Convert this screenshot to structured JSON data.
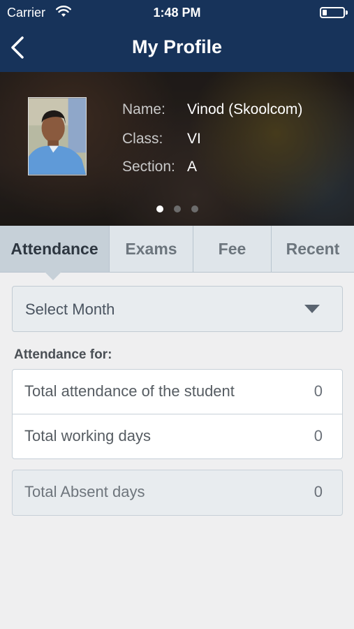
{
  "status_bar": {
    "carrier": "Carrier",
    "time": "1:48 PM",
    "battery_level": 0.2
  },
  "header": {
    "title": "My Profile",
    "back_icon": "chevron-left-icon"
  },
  "profile": {
    "name_label": "Name:",
    "name_value": "Vinod (Skoolcom)",
    "class_label": "Class:",
    "class_value": "VI",
    "section_label": "Section:",
    "section_value": "A",
    "carousel_pages": 3,
    "carousel_active": 1
  },
  "tabs": [
    {
      "label": "Attendance",
      "active": true
    },
    {
      "label": "Exams",
      "active": false
    },
    {
      "label": "Fee",
      "active": false
    },
    {
      "label": "Recent",
      "active": false
    }
  ],
  "month_select": {
    "placeholder": "Select Month",
    "icon": "caret-down-icon"
  },
  "attendance": {
    "heading": "Attendance for:",
    "rows": [
      {
        "label": "Total attendance of the student",
        "value": "0"
      },
      {
        "label": "Total working days",
        "value": "0"
      }
    ],
    "absent": {
      "label": "Total Absent days",
      "value": "0"
    }
  },
  "colors": {
    "header_bg": "#17335a",
    "tab_active_bg": "#c6d0d8",
    "tab_bg": "#dfe5ea",
    "page_bg": "#efeff0"
  }
}
